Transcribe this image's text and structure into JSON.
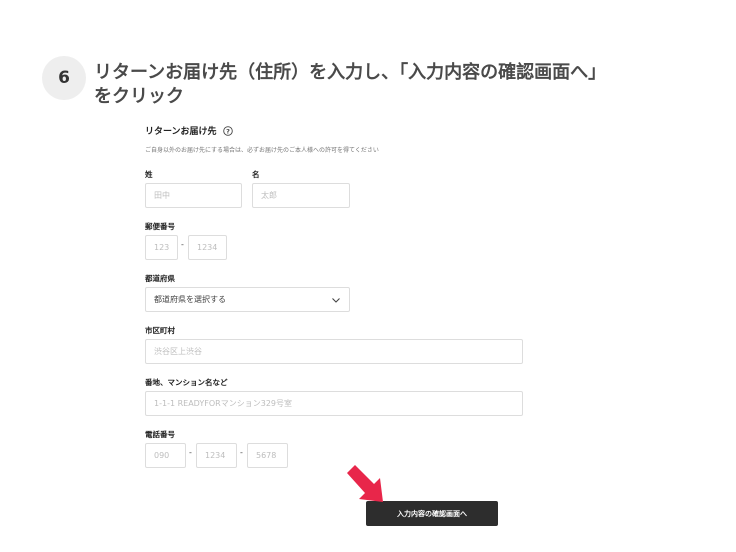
{
  "step": {
    "number": "6",
    "title_line1": "リターンお届け先（住所）を入力し、「入力内容の確認画面へ」",
    "title_line2": "をクリック"
  },
  "form": {
    "section_title": "リターンお届け先",
    "note": "ご自身以外のお届け先にする場合は、必ずお届け先のご本人様への許可を得てください",
    "last_name": {
      "label": "姓",
      "placeholder": "田中"
    },
    "first_name": {
      "label": "名",
      "placeholder": "太郎"
    },
    "postal": {
      "label": "郵便番号",
      "placeholder1": "123",
      "placeholder2": "1234",
      "separator": "-"
    },
    "prefecture": {
      "label": "都道府県",
      "value": "都道府県を選択する"
    },
    "city": {
      "label": "市区町村",
      "placeholder": "渋谷区上渋谷"
    },
    "address": {
      "label": "番地、マンション名など",
      "placeholder": "1-1-1 READYFORマンション329号室"
    },
    "phone": {
      "label": "電話番号",
      "placeholder1": "090",
      "placeholder2": "1234",
      "placeholder3": "5678",
      "separator": "-"
    },
    "submit_label": "入力内容の確認画面へ"
  },
  "colors": {
    "button": "#2d2d2d",
    "arrow": "#e8264a",
    "border": "#dddddd"
  },
  "icons": {
    "help": "question-circle-icon",
    "dropdown": "chevron-down-icon",
    "pointer": "arrow-pointer-icon"
  }
}
